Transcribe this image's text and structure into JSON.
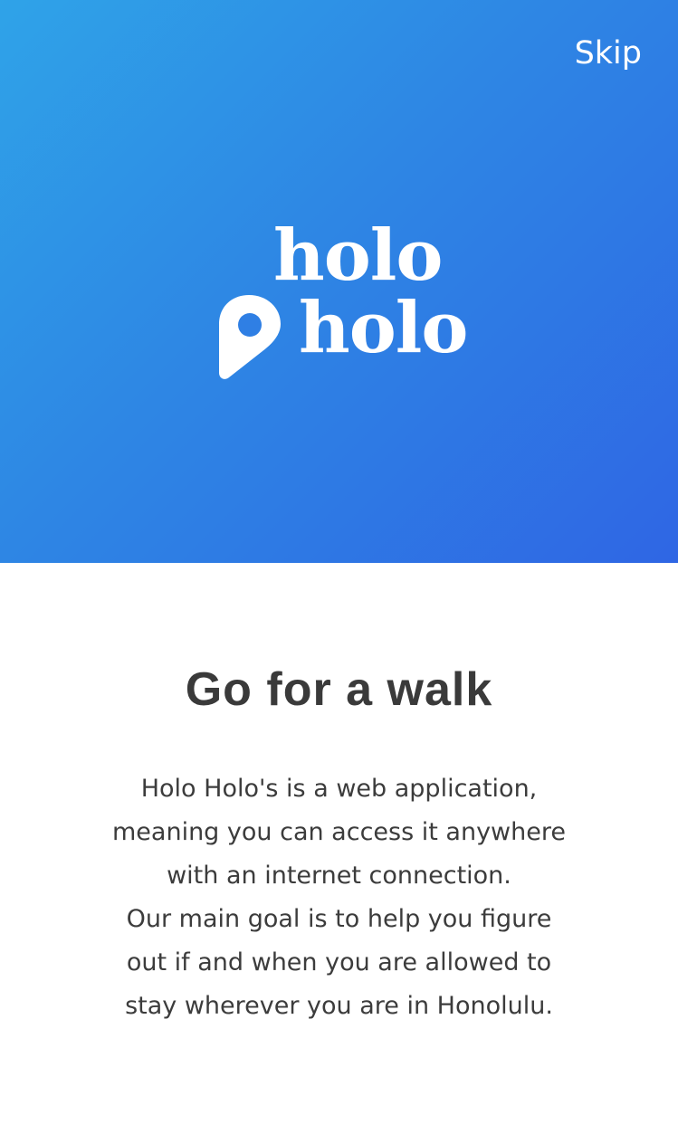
{
  "header": {
    "skip_label": "Skip"
  },
  "logo": {
    "line1": "holo",
    "line2": "holo",
    "icon": "map-pin-icon"
  },
  "main": {
    "title": "Go for a walk",
    "description_lines": [
      "Holo Holo's is a web application,",
      "meaning you can access it anywhere",
      "with an internet connection.",
      "Our main goal is to help you figure",
      "out if and when you are allowed to",
      "stay wherever you are in Honolulu."
    ]
  },
  "colors": {
    "gradient_start": "#2fa3e8",
    "gradient_end": "#2f66e4",
    "text_dark": "#3a3a3a",
    "white": "#ffffff"
  }
}
